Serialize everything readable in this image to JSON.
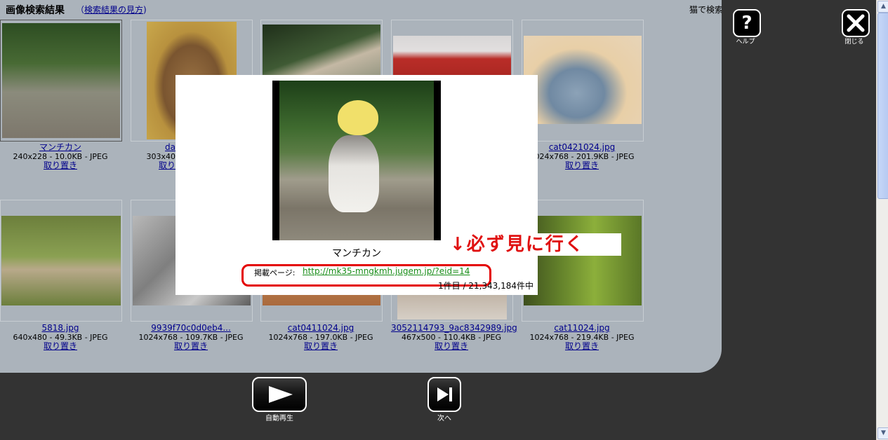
{
  "results": {
    "title": "画像検索結果",
    "how_prefix": "（",
    "how_link": "検索結果の見方",
    "how_suffix": ")",
    "query_text": "猫で検索"
  },
  "items": [
    {
      "filename": "マンチカン",
      "meta": "240x228 - 10.0KB - JPEG",
      "keep": "取り置き"
    },
    {
      "filename": "da",
      "meta": "303x40",
      "keep": "取り"
    },
    {
      "filename": "",
      "meta": "",
      "keep": ""
    },
    {
      "filename": "",
      "meta": "",
      "keep": ""
    },
    {
      "filename": "cat0421024.jpg",
      "meta": "1024x768 - 201.9KB - JPEG",
      "keep": "取り置き"
    },
    {
      "filename": "5818.jpg",
      "meta": "640x480 - 49.3KB - JPEG",
      "keep": "取り置き"
    },
    {
      "filename": "9939f70c0d0eb4...",
      "meta": "1024x768 - 109.7KB - JPEG",
      "keep": "取り置き"
    },
    {
      "filename": "cat0411024.jpg",
      "meta": "1024x768 - 197.0KB - JPEG",
      "keep": "取り置き"
    },
    {
      "filename": "3052114793_9ac8342989.jpg",
      "meta": "467x500 - 110.4KB - JPEG",
      "keep": "取り置き"
    },
    {
      "filename": "cat11024.jpg",
      "meta": "1024x768 - 219.4KB - JPEG",
      "keep": "取り置き"
    }
  ],
  "popup": {
    "caption": "マンチカン",
    "source_label": "掲載ページ:",
    "source_url": "http://mk35-mngkmh.jugem.jp/?eid=14",
    "counter": "1件目 / 21,343,184件中"
  },
  "annotation": {
    "text": "↓必ず見に行く",
    "color": "#e01010"
  },
  "top_buttons": {
    "help_label": "ヘルプ",
    "close_label": "閉じる"
  },
  "bottom_buttons": {
    "autoplay_label": "自動再生",
    "next_label": "次へ"
  },
  "scrollbar": {
    "up": "▲",
    "down": "▼"
  },
  "icons": {
    "help": "question-icon",
    "close": "close-icon",
    "play": "play-icon",
    "next": "next-icon"
  },
  "colors": {
    "link": "#00008b",
    "source_url": "#188d18",
    "highlight": "#e40000"
  }
}
